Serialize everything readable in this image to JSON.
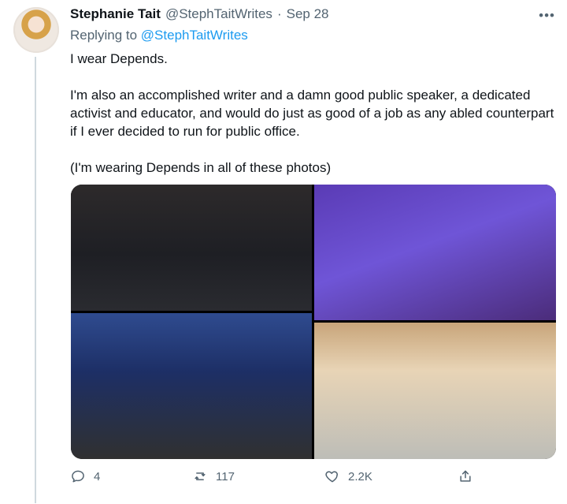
{
  "tweet": {
    "author": {
      "name": "Stephanie Tait",
      "handle": "@StephTaitWrites"
    },
    "separator": "·",
    "date": "Sep 28",
    "more_label": "•••",
    "replying_prefix": "Replying to",
    "replying_handle": "@StephTaitWrites",
    "text": {
      "line1": "I wear Depends.",
      "line2": "I'm also an accomplished writer and a damn good public speaker, a dedicated activist and educator, and would do just as good of a job as any abled counterpart if I ever decided to run for public office.",
      "line3": "(I'm wearing Depends in all of these photos)"
    },
    "media": {
      "photos": [
        {
          "label": ""
        },
        {
          "label": ""
        },
        {
          "label": ""
        },
        {
          "label": ""
        }
      ]
    },
    "actions": {
      "replies": "4",
      "retweets": "117",
      "likes": "2.2K"
    }
  },
  "icons": {
    "reply": "reply-icon",
    "retweet": "retweet-icon",
    "like": "heart-icon",
    "share": "share-icon"
  }
}
